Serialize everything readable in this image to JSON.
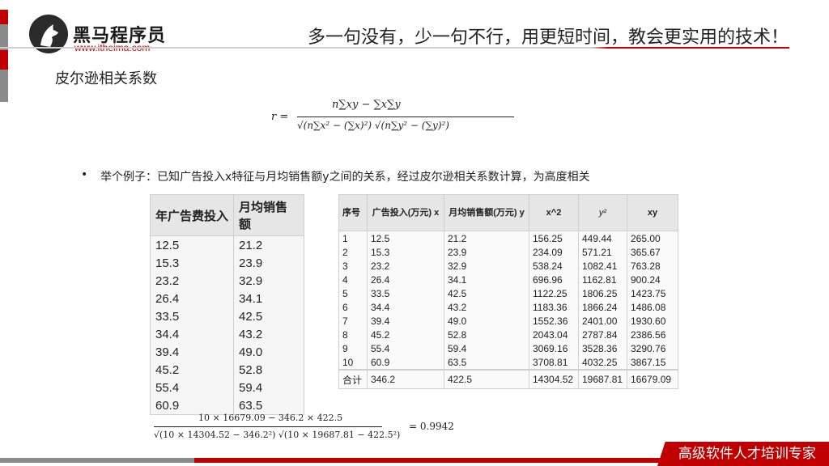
{
  "header": {
    "brand_name": "黑马程序员",
    "brand_url": "www.itheima.com",
    "slogan": "多一句没有，少一句不行，用更短时间，教会更实用的技术！"
  },
  "page_title": "皮尔逊相关系数",
  "formula": {
    "lhs": "r =",
    "numerator": "n∑xy − ∑x∑y",
    "denominator": "√(n∑x² − (∑x)²) √(n∑y² − (∑y)²)"
  },
  "bullet": {
    "marker": "•",
    "text": "举个例子：已知广告投入x特征与月均销售额y之间的关系，经过皮尔逊相关系数计算，为高度相关"
  },
  "table1": {
    "headers": [
      "年广告费投入",
      "月均销售额"
    ],
    "rows": [
      [
        "12.5",
        "21.2"
      ],
      [
        "15.3",
        "23.9"
      ],
      [
        "23.2",
        "32.9"
      ],
      [
        "26.4",
        "34.1"
      ],
      [
        "33.5",
        "42.5"
      ],
      [
        "34.4",
        "43.2"
      ],
      [
        "39.4",
        "49.0"
      ],
      [
        "45.2",
        "52.8"
      ],
      [
        "55.4",
        "59.4"
      ],
      [
        "60.9",
        "63.5"
      ]
    ]
  },
  "table2": {
    "headers": [
      "序号",
      "广告投入(万元) x",
      "月均销售额(万元) y",
      "x^2",
      "y²",
      "xy"
    ],
    "rows": [
      [
        "1",
        "12.5",
        "21.2",
        "156.25",
        "449.44",
        "265.00"
      ],
      [
        "2",
        "15.3",
        "23.9",
        "234.09",
        "571.21",
        "365.67"
      ],
      [
        "3",
        "23.2",
        "32.9",
        "538.24",
        "1082.41",
        "763.28"
      ],
      [
        "4",
        "26.4",
        "34.1",
        "696.96",
        "1162.81",
        "900.24"
      ],
      [
        "5",
        "33.5",
        "42.5",
        "1122.25",
        "1806.25",
        "1423.75"
      ],
      [
        "6",
        "34.4",
        "43.2",
        "1183.36",
        "1866.24",
        "1486.08"
      ],
      [
        "7",
        "39.4",
        "49.0",
        "1552.36",
        "2401.00",
        "1930.60"
      ],
      [
        "8",
        "45.2",
        "52.8",
        "2043.04",
        "2787.84",
        "2386.56"
      ],
      [
        "9",
        "55.4",
        "59.4",
        "3069.16",
        "3528.36",
        "3290.76"
      ],
      [
        "10",
        "60.9",
        "63.5",
        "3708.81",
        "4032.25",
        "3867.15"
      ]
    ],
    "total": [
      "合计",
      "346.2",
      "422.5",
      "14304.52",
      "19687.81",
      "16679.09"
    ]
  },
  "calculation": {
    "numerator": "10 × 16679.09 − 346.2 × 422.5",
    "denominator": "√(10 × 14304.52 − 346.2²) √(10 × 19687.81 − 422.5²)",
    "result": "= 0.9942"
  },
  "footer": {
    "tagline": "高级软件人才培训专家"
  },
  "colors": {
    "accent": "#c00000",
    "gray": "#8a8a8a"
  }
}
